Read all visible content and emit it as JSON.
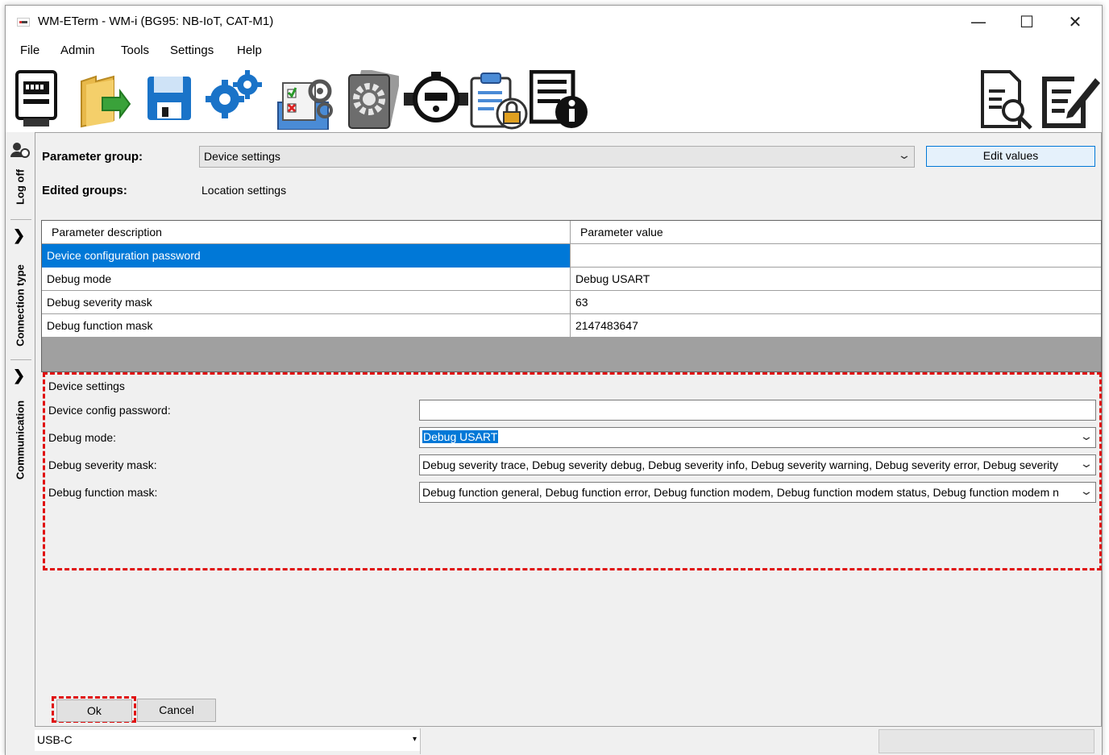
{
  "window": {
    "title": "WM-ETerm - WM-i (BG95: NB-IoT, CAT-M1)",
    "controls": {
      "minimize": "—",
      "maximize": "☐",
      "close": "✕"
    }
  },
  "menu": {
    "items": [
      "File",
      "Admin",
      "Tools",
      "Settings",
      "Help"
    ]
  },
  "toolbar": {
    "icons": [
      "meter-icon",
      "open-folder-icon",
      "save-icon",
      "settings-gears-icon",
      "config-checklist-icon",
      "firmware-gear-icon",
      "water-meter-icon",
      "locked-clipboard-icon",
      "info-document-icon",
      "search-document-icon",
      "edit-document-icon"
    ]
  },
  "sidetabs": {
    "logoff": "Log off",
    "connection_type": "Connection type",
    "communication": "Communication",
    "chevron": "❯"
  },
  "param": {
    "group_label": "Parameter group:",
    "group_value": "Device settings",
    "edit_values": "Edit values",
    "edited_label": "Edited groups:",
    "edited_value": "Location settings"
  },
  "grid": {
    "columns": [
      "Parameter description",
      "Parameter value"
    ],
    "rows": [
      {
        "desc": "Device configuration password",
        "value": ""
      },
      {
        "desc": "Debug mode",
        "value": "Debug USART"
      },
      {
        "desc": "Debug severity mask",
        "value": "63"
      },
      {
        "desc": "Debug function mask",
        "value": "2147483647"
      }
    ]
  },
  "settings": {
    "group_title": "Device settings",
    "password_label": "Device config password:",
    "password_value": "",
    "debug_mode_label": "Debug mode:",
    "debug_mode_value": "Debug USART",
    "severity_label": "Debug severity mask:",
    "severity_value": "Debug severity trace, Debug severity debug, Debug severity info, Debug severity warning, Debug severity error, Debug severity",
    "function_label": "Debug function mask:",
    "function_value": "Debug function general, Debug function error, Debug function modem, Debug function modem status, Debug function modem n"
  },
  "actions": {
    "ok": "Ok",
    "cancel": "Cancel"
  },
  "status": {
    "port": "USB-C",
    "arrow": "▾"
  },
  "colors": {
    "selection": "#0078d7",
    "highlight_dash": "#e01010",
    "edit_border": "#0078d7"
  }
}
